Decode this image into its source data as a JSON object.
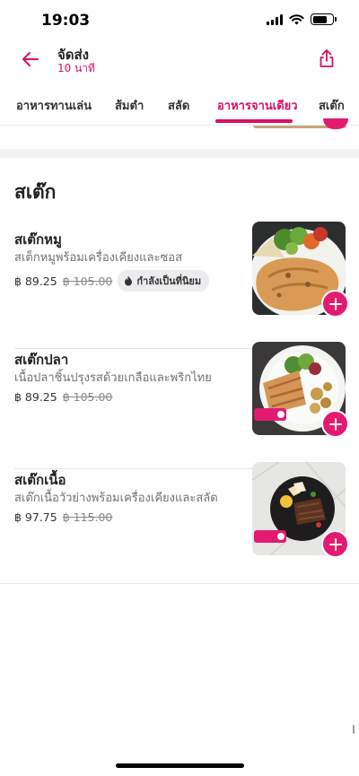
{
  "status_bar": {
    "time": "19:03"
  },
  "header": {
    "title": "จัดส่ง",
    "subtitle": "10 นาที",
    "back_icon": "arrow-left-icon",
    "share_icon": "share-icon"
  },
  "tabs": [
    {
      "label": "อาหารทานเล่น",
      "active": false
    },
    {
      "label": "ส้มตำ",
      "active": false
    },
    {
      "label": "สลัด",
      "active": false
    },
    {
      "label": "อาหารจานเดียว",
      "active": true
    },
    {
      "label": "สเต๊ก",
      "active": false
    }
  ],
  "section": {
    "title": "สเต๊ก",
    "items": [
      {
        "name": "สเต๊กหมู",
        "description": "สเต็กหมูพร้อมเครื่องเคียงและซอส",
        "price": "฿ 89.25",
        "old_price": "฿ 105.00",
        "badge": "กำลังเป็นที่นิยม"
      },
      {
        "name": "สเต๊กปลา",
        "description": "เนื้อปลาชิ้นปรุงรสด้วยเกลือและพริกไทย",
        "price": "฿ 89.25",
        "old_price": "฿ 105.00"
      },
      {
        "name": "สเต๊กเนื้อ",
        "description": "สเต๊กเนื้อวัวย่างพร้อมเครื่องเคียงและสลัด",
        "price": "฿ 97.75",
        "old_price": "฿ 115.00"
      }
    ]
  },
  "colors": {
    "accent": "#d70f64",
    "add_button": "#e21b70"
  }
}
